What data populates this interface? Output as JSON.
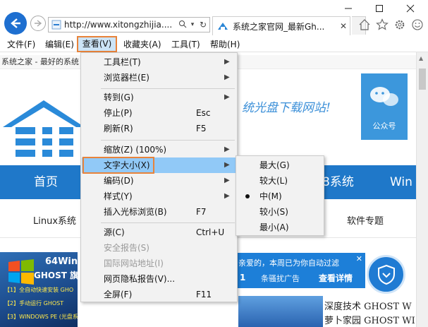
{
  "browser": {
    "url": "http://www.xitongzhijia....",
    "tab_title": "系统之家官网_最新Gh...",
    "colors": {
      "accent": "#1e6fd0",
      "highlight": "#91c9f7",
      "callout": "#e8833a"
    }
  },
  "menubar": {
    "items": [
      "文件(F)",
      "编辑(E)",
      "查看(V)",
      "收藏夹(A)",
      "工具(T)",
      "帮助(H)"
    ],
    "active": "查看(V)"
  },
  "view_menu": {
    "items": [
      {
        "label": "工具栏(T)",
        "submenu": true
      },
      {
        "label": "浏览器栏(E)",
        "submenu": true
      },
      {
        "label": "转到(G)",
        "submenu": true
      },
      {
        "label": "停止(P)",
        "shortcut": "Esc"
      },
      {
        "label": "刷新(R)",
        "shortcut": "F5"
      },
      {
        "label": "缩放(Z) (100%)",
        "submenu": true
      },
      {
        "label": "文字大小(X)",
        "submenu": true,
        "highlighted": true
      },
      {
        "label": "编码(D)",
        "submenu": true
      },
      {
        "label": "样式(Y)",
        "submenu": true
      },
      {
        "label": "插入光标浏览(B)",
        "shortcut": "F7"
      },
      {
        "label": "源(C)",
        "shortcut": "Ctrl+U"
      },
      {
        "label": "安全报告(S)",
        "disabled": true
      },
      {
        "label": "国际网站地址(I)",
        "disabled": true
      },
      {
        "label": "网页隐私报告(V)..."
      },
      {
        "label": "全屏(F)",
        "shortcut": "F11"
      }
    ]
  },
  "text_size_menu": {
    "items": [
      "最大(G)",
      "较大(L)",
      "中(M)",
      "较小(S)",
      "最小(A)"
    ],
    "selected": "中(M)"
  },
  "page": {
    "site_strip": "系统之家 - 最好的系统",
    "slogan": "统光盘下载网站!",
    "wechat_label": "公众号",
    "nav": {
      "home": "首页",
      "system": "8系统",
      "win": "Win"
    },
    "sub_nav": {
      "linux": "Linux系统",
      "software": "软件专题"
    },
    "banner": {
      "title": "64Win7",
      "subtitle": "GHOST 旗",
      "line1": "【1】全自动快速安装 GHO",
      "line2": "【2】手动运行 GHOST",
      "line3": "【3】WINDOWS PE (光盘系统)"
    },
    "notification": {
      "line1": "亲爱的，本周已为你自动过滤",
      "count": "1",
      "line2": "条骚扰广告",
      "action": "查看详情"
    },
    "right_text1": "深度技术 GHOST W",
    "right_text2": "萝卜家园 GHOST WI"
  }
}
